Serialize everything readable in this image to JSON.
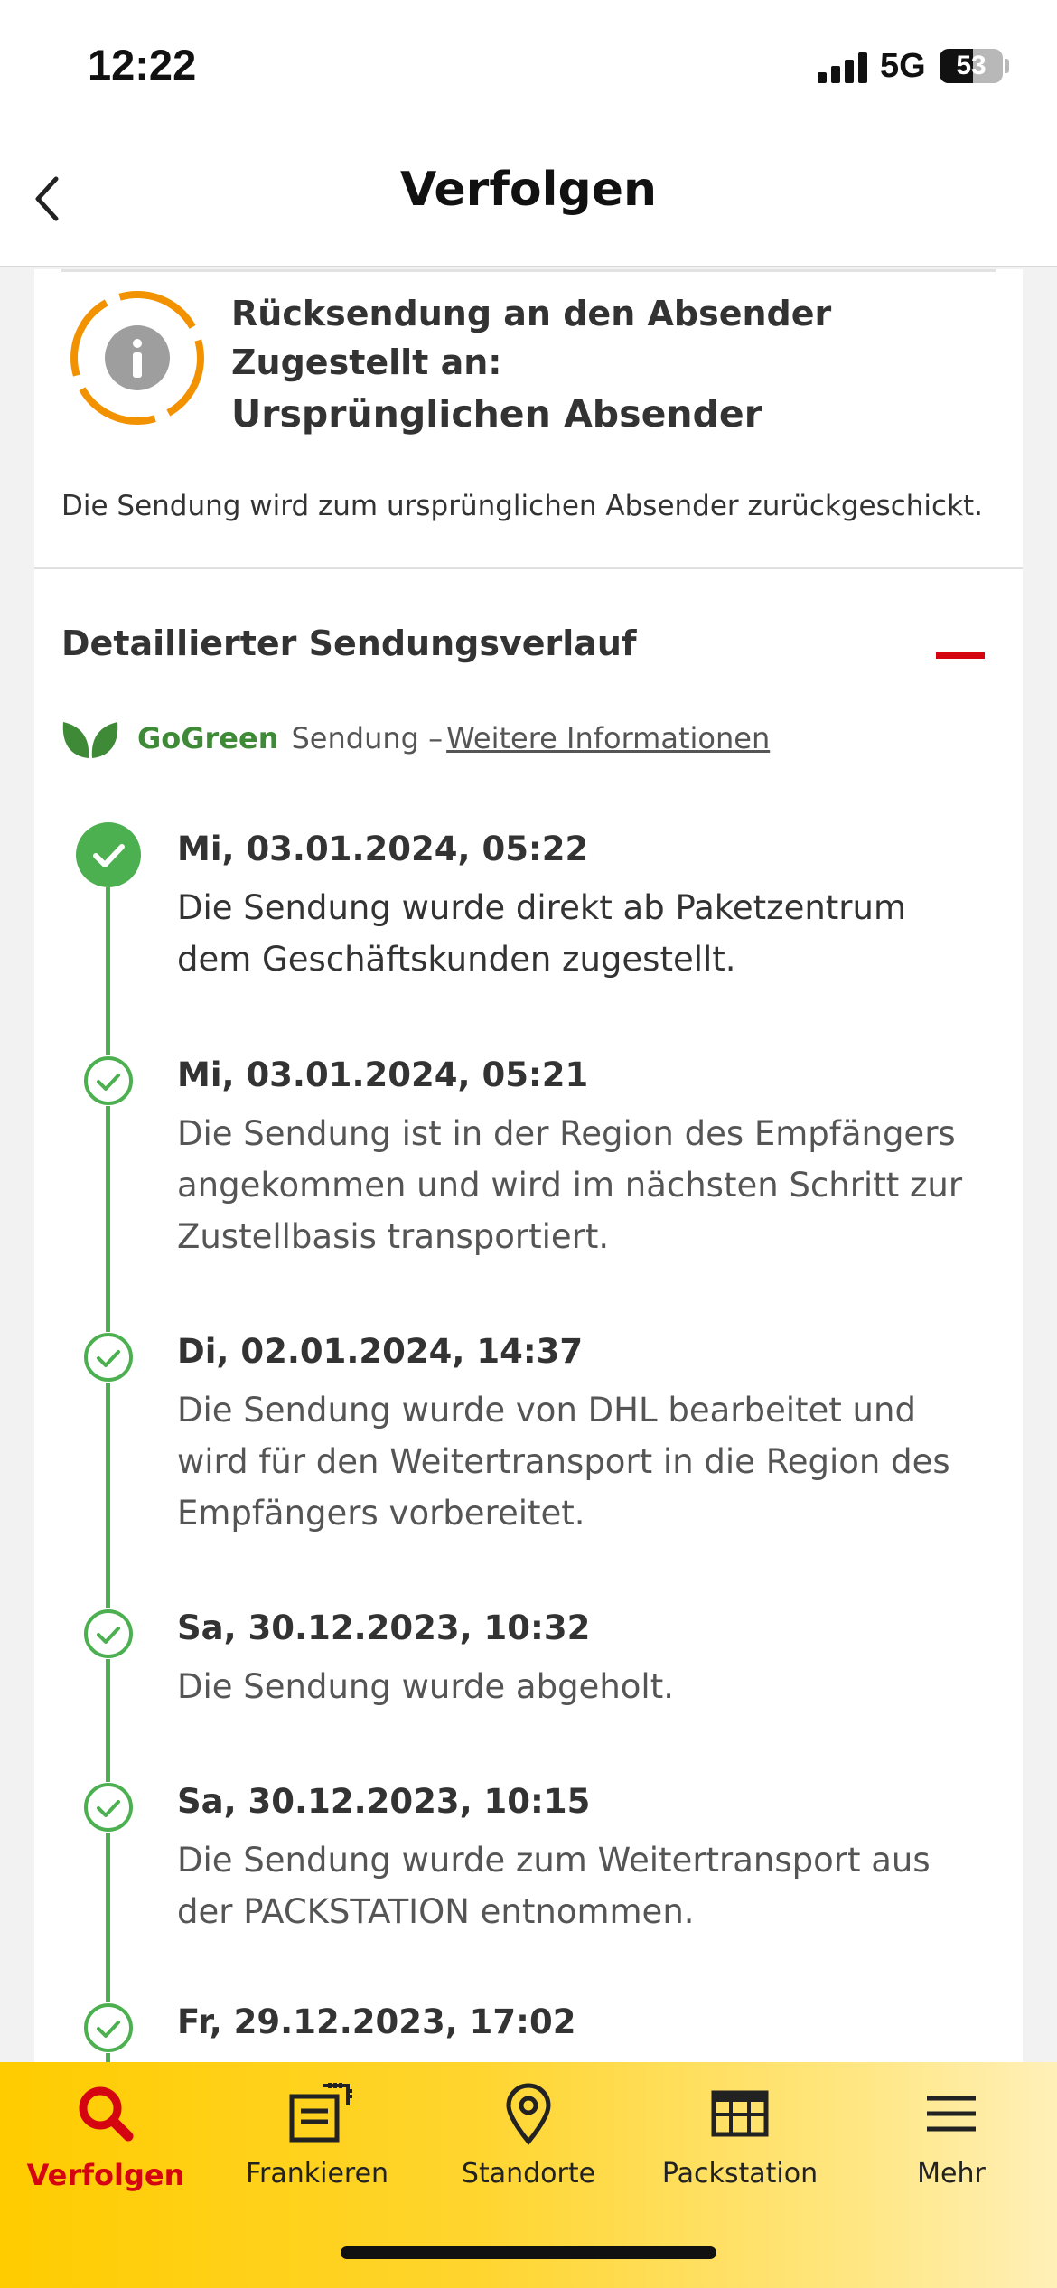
{
  "status_bar": {
    "time": "12:22",
    "network": "5G",
    "battery_percent": 53,
    "battery_text": "53"
  },
  "header": {
    "title": "Verfolgen",
    "back_icon": "chevron-left-icon"
  },
  "return_notice": {
    "icon": "info-icon",
    "line1": "Rücksendung an den Absender",
    "line2": "Zugestellt an:",
    "line3": "Ursprünglichen Absender",
    "description": "Die Sendung wird zum ursprünglichen Absender zurückgeschickt."
  },
  "history": {
    "title": "Detaillierter Sendungsverlauf",
    "collapse_icon": "minus-icon",
    "gogreen_label": "GoGreen",
    "shipment_label": "Sendung –",
    "more_info_link": "Weitere Informationen",
    "events": [
      {
        "date": "Mi, 03.01.2024, 05:22",
        "text": "Die Sendung wurde direkt ab Paketzentrum dem Geschäftskunden zugestellt."
      },
      {
        "date": "Mi, 03.01.2024, 05:21",
        "text": "Die Sendung ist in der Region des Empfängers angekommen und wird im nächsten Schritt zur Zustellbasis transportiert."
      },
      {
        "date": "Di, 02.01.2024, 14:37",
        "text": "Die Sendung wurde von DHL bearbeitet und wird für den Weitertransport in die Region des Empfängers vorbereitet."
      },
      {
        "date": "Sa, 30.12.2023, 10:32",
        "text": "Die Sendung wurde abgeholt."
      },
      {
        "date": "Sa, 30.12.2023, 10:15",
        "text": "Die Sendung wurde zum Weitertransport aus der PACKSTATION entnommen."
      },
      {
        "date": "Fr, 29.12.2023, 17:02",
        "text": ""
      }
    ]
  },
  "tabbar": {
    "tabs": [
      {
        "label": "Verfolgen",
        "icon": "search-icon",
        "active": true
      },
      {
        "label": "Frankieren",
        "icon": "stamp-icon",
        "active": false
      },
      {
        "label": "Standorte",
        "icon": "location-pin-icon",
        "active": false
      },
      {
        "label": "Packstation",
        "icon": "packstation-icon",
        "active": false
      },
      {
        "label": "Mehr",
        "icon": "menu-icon",
        "active": false
      }
    ]
  },
  "colors": {
    "accent_red": "#d40511",
    "dhl_yellow": "#ffcc00",
    "timeline_green": "#4caf50",
    "gogreen_green": "#3e8a37",
    "info_orange": "#f39200"
  }
}
